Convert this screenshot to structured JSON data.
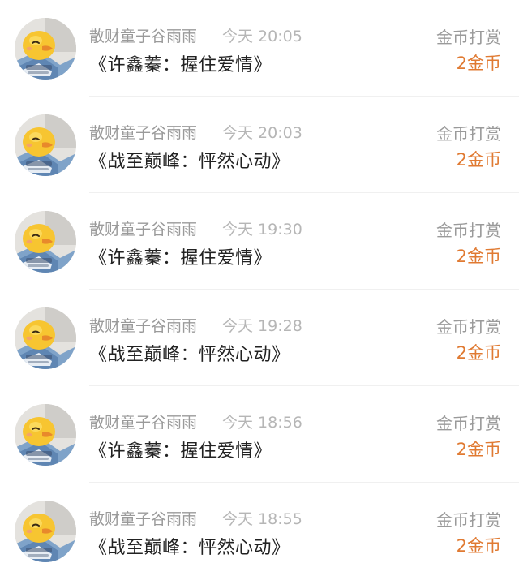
{
  "colors": {
    "amount": "#e07a32",
    "muted_text": "#9a9a9a",
    "time_text": "#b6b6b6",
    "title_text": "#222222"
  },
  "records": [
    {
      "avatar_icon": "duck-avatar-icon",
      "user": "散财童子谷雨雨",
      "time": "今天 20:05",
      "work": "《许鑫蓁：握住爱情》",
      "action": "金币打赏",
      "amount": "2金币"
    },
    {
      "avatar_icon": "duck-avatar-icon",
      "user": "散财童子谷雨雨",
      "time": "今天 20:03",
      "work": "《战至巅峰：怦然心动》",
      "action": "金币打赏",
      "amount": "2金币"
    },
    {
      "avatar_icon": "duck-avatar-icon",
      "user": "散财童子谷雨雨",
      "time": "今天 19:30",
      "work": "《许鑫蓁：握住爱情》",
      "action": "金币打赏",
      "amount": "2金币"
    },
    {
      "avatar_icon": "duck-avatar-icon",
      "user": "散财童子谷雨雨",
      "time": "今天 19:28",
      "work": "《战至巅峰：怦然心动》",
      "action": "金币打赏",
      "amount": "2金币"
    },
    {
      "avatar_icon": "duck-avatar-icon",
      "user": "散财童子谷雨雨",
      "time": "今天 18:56",
      "work": "《许鑫蓁：握住爱情》",
      "action": "金币打赏",
      "amount": "2金币"
    },
    {
      "avatar_icon": "duck-avatar-icon",
      "user": "散财童子谷雨雨",
      "time": "今天 18:55",
      "work": "《战至巅峰：怦然心动》",
      "action": "金币打赏",
      "amount": "2金币"
    }
  ]
}
